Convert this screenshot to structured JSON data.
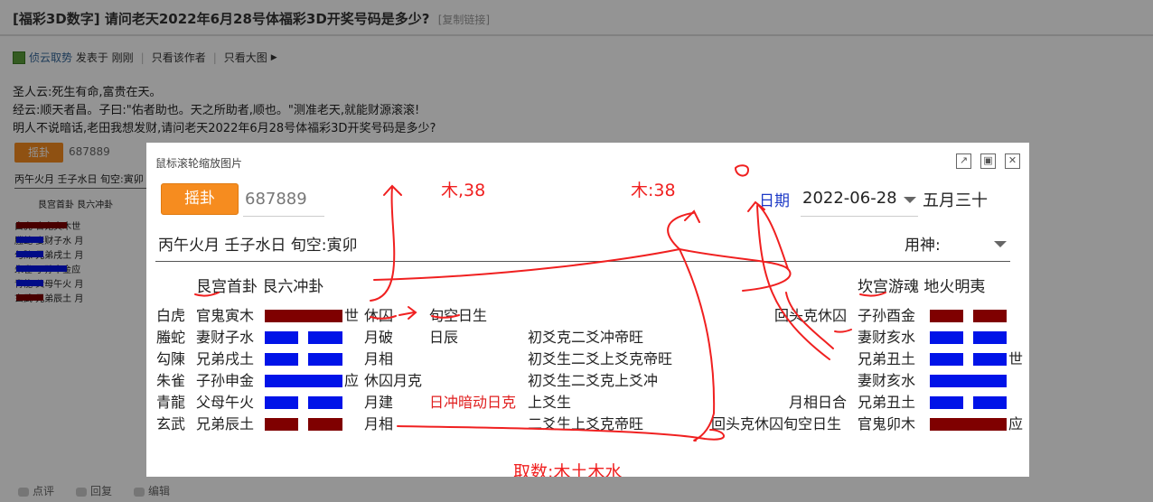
{
  "thread": {
    "title": "[福彩3D数字] 请问老天2022年6月28号体福彩3D开奖号码是多少?",
    "copy_link": "[复制链接]"
  },
  "author_bar": {
    "user": "侦云取势",
    "posted": "发表于 刚刚",
    "only_author": "只看该作者",
    "large_image": "只看大图"
  },
  "post": {
    "lines": [
      "圣人云:死生有命,富贵在天。",
      "经云:顺天者昌。子曰:\"佑者助也。天之所助者,顺也。\"测准老天,就能财源滚滚!",
      "明人不说暗话,老田我想发财,请问老天2022年6月28号体福彩3D开奖号码是多少?"
    ]
  },
  "background_preview": {
    "button": "摇卦",
    "number": "687889",
    "ganzhi": "丙午火月 壬子水日 旬空:寅卯",
    "gua": "艮宫首卦 艮六冲卦",
    "rows": [
      {
        "god": "白虎",
        "yao": "官鬼寅木",
        "mark": "世"
      },
      {
        "god": "螣蛇",
        "yao": "妻财子水",
        "mark": "月"
      },
      {
        "god": "勾陳",
        "yao": "兄弟戌土",
        "mark": "月"
      },
      {
        "god": "朱雀",
        "yao": "子孙申金",
        "mark": "应"
      },
      {
        "god": "青龍",
        "yao": "父母午火",
        "mark": "月"
      },
      {
        "god": "玄武",
        "yao": "兄弟辰土",
        "mark": "月"
      }
    ]
  },
  "footer": {
    "rate": "点评",
    "reply": "回复",
    "edit": "编辑"
  },
  "modal": {
    "hint": "鼠标滚轮缩放图片",
    "shake_button": "摇卦",
    "number": "687889",
    "date_label": "日期",
    "date_value": "2022-06-28",
    "lunar": "五月三十",
    "ganzhi": "丙午火月 壬子水日 旬空:寅卯",
    "yongshen_label": "用神:",
    "left_gua": "艮宫首卦 艮六冲卦",
    "right_gua": "坎宫游魂 地火明夷",
    "left_rows": [
      {
        "god": "白虎",
        "yao": "官鬼寅木",
        "type": "yang",
        "color": "#7f0000",
        "mark": "世",
        "status": "休囚",
        "note": "旬空日生",
        "note2": ""
      },
      {
        "god": "螣蛇",
        "yao": "妻财子水",
        "type": "yin",
        "color": "#0013e8",
        "mark": "",
        "status": "月破",
        "note": "日辰",
        "note2": "初爻克二爻冲帝旺"
      },
      {
        "god": "勾陳",
        "yao": "兄弟戌土",
        "type": "yin",
        "color": "#0013e8",
        "mark": "",
        "status": "月相",
        "note": "",
        "note2": "初爻生二爻上爻克帝旺"
      },
      {
        "god": "朱雀",
        "yao": "子孙申金",
        "type": "yang",
        "color": "#0013e8",
        "mark": "应",
        "status": "休囚月克",
        "note": "",
        "note2": "初爻生二爻克上爻冲"
      },
      {
        "god": "青龍",
        "yao": "父母午火",
        "type": "yin",
        "color": "#0013e8",
        "mark": "",
        "status": "月建",
        "note": "日冲暗动日克",
        "note2": "上爻生"
      },
      {
        "god": "玄武",
        "yao": "兄弟辰土",
        "type": "yin",
        "color": "#7f0000",
        "mark": "",
        "status": "月相",
        "note": "",
        "note2": "二爻生上爻克帝旺"
      }
    ],
    "right_rows": [
      {
        "pre": "回头克休囚",
        "yao": "子孙酉金",
        "type": "yin",
        "color": "#7f0000",
        "mark": ""
      },
      {
        "pre": "",
        "yao": "妻财亥水",
        "type": "yin",
        "color": "#0013e8",
        "mark": ""
      },
      {
        "pre": "",
        "yao": "兄弟丑土",
        "type": "yin",
        "color": "#0013e8",
        "mark": "世"
      },
      {
        "pre": "",
        "yao": "妻财亥水",
        "type": "yang",
        "color": "#0013e8",
        "mark": ""
      },
      {
        "pre": "月相日合",
        "yao": "兄弟丑土",
        "type": "yin",
        "color": "#0013e8",
        "mark": ""
      },
      {
        "pre": "回头克休囚旬空日生",
        "yao": "官鬼卯木",
        "type": "yang",
        "color": "#7f0000",
        "mark": "应"
      }
    ],
    "annotations": {
      "mu_38_a": "木,38",
      "mu_38_b": "木:38",
      "qushu": "取数:木土木水"
    }
  }
}
